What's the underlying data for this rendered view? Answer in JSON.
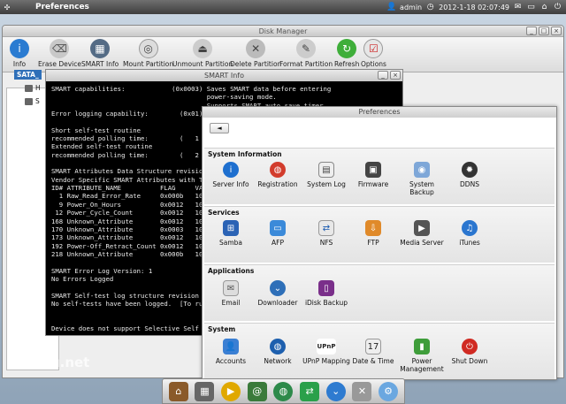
{
  "topbar": {
    "title": "Preferences",
    "user": "admin",
    "datetime": "2012-1-18 02:07:49"
  },
  "disk_manager": {
    "title": "Disk Manager",
    "toolbar": [
      "Info",
      "Erase Device",
      "SMART Info",
      "Mount Partition",
      "Unmount Partition",
      "Delete Partition",
      "Format Partition",
      "Refresh",
      "Options"
    ],
    "tree_root": "SATA_",
    "tree_nodes": [
      "H",
      "S"
    ]
  },
  "smart_info": {
    "title": "SMART Info",
    "lines": [
      "SMART capabilities:            (0x0003) Saves SMART data before entering",
      "                                        power-saving mode.",
      "                                        Supports SMART auto save timer.",
      "Error logging capability:        (0x01)",
      "",
      "Short self-test routine",
      "recommended polling time:        (   1",
      "Extended self-test routine",
      "recommended polling time:        (   2",
      "",
      "SMART Attributes Data Structure revisio",
      "Vendor Specific SMART Attributes with T",
      "ID# ATTRIBUTE_NAME          FLAG     VA",
      "  1 Raw_Read_Error_Rate     0x000b   10",
      "  9 Power_On_Hours          0x0012   10",
      " 12 Power_Cycle_Count       0x0012   10",
      "168 Unknown_Attribute       0x0012   10",
      "170 Unknown_Attribute       0x0003   10",
      "173 Unknown_Attribute       0x0012   10",
      "192 Power-Off_Retract_Count 0x0012   10",
      "218 Unknown_Attribute       0x000b   10",
      "",
      "SMART Error Log Version: 1",
      "No Errors Logged",
      "",
      "SMART Self-test log structure revision",
      "No self-tests have been logged.  [To ru",
      "",
      "",
      "Device does not support Selective Self"
    ]
  },
  "preferences": {
    "title": "Preferences",
    "back": "◄",
    "sections": [
      {
        "name": "System Information",
        "items": [
          "Server Info",
          "Registration",
          "System Log",
          "Firmware",
          "System Backup",
          "DDNS"
        ]
      },
      {
        "name": "Services",
        "items": [
          "Samba",
          "AFP",
          "NFS",
          "FTP",
          "Media Server",
          "iTunes"
        ]
      },
      {
        "name": "Applications",
        "items": [
          "Email",
          "Downloader",
          "iDisk Backup"
        ]
      },
      {
        "name": "System",
        "items": [
          "Accounts",
          "Network",
          "UPnP Mapping",
          "Date & Time",
          "Power Management",
          "Shut Down"
        ]
      }
    ]
  },
  "watermark": "metku.net"
}
